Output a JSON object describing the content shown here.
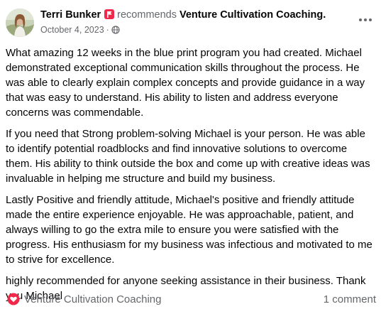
{
  "post": {
    "author": "Terri Bunker",
    "recommends_text": "recommends",
    "page_name": "Venture Cultivation Coaching",
    "page_suffix": ".",
    "date": "October 4, 2023",
    "separator": "·",
    "icons": {
      "recommend_badge": "recommend-flag-icon",
      "audience": "globe-icon",
      "more": "more-options-icon",
      "rating": "heart-icon"
    },
    "colors": {
      "recommend_badge": "#f02849",
      "text": "#050505",
      "secondary_text": "#65676b"
    }
  },
  "body": {
    "paragraphs": [
      "What amazing 12 weeks in the blue print program you had created. Michael demonstrated exceptional communication skills throughout the process. He was able to clearly explain complex concepts and provide guidance in a way that was easy to understand. His ability to listen and address everyone concerns was commendable.",
      "If you need that Strong problem-solving Michael is your person. He was able to identify potential roadblocks and find innovative solutions to overcome them. His ability to think outside the box and come up with creative ideas was invaluable in helping me structure and build my business.",
      "Lastly Positive and friendly attitude, Michael's positive and friendly attitude made the entire experience enjoyable. He was approachable, patient, and always willing to go the extra mile to ensure you were satisfied with the progress. His enthusiasm for my business was infectious and motivated to me to strive for excellence.",
      "highly recommended for anyone seeking assistance in their business.  Thank you Michael"
    ]
  },
  "footer": {
    "page_name": "Venture Cultivation Coaching",
    "comment_count": "1 comment"
  }
}
